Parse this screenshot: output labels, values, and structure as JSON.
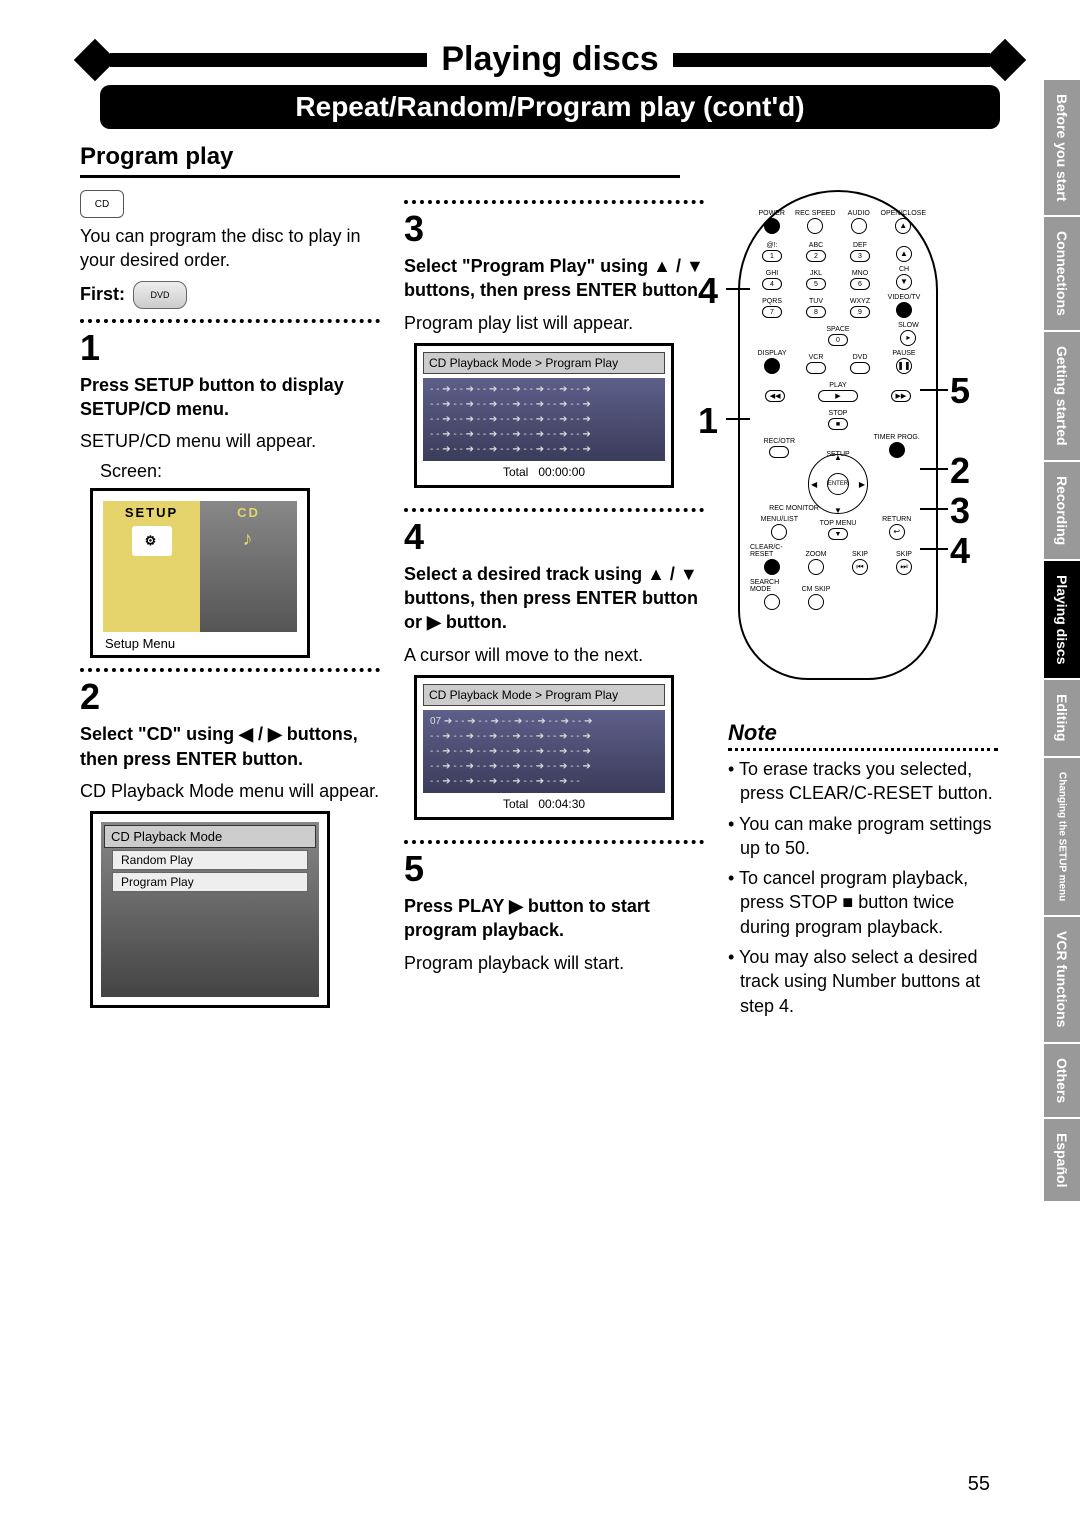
{
  "header": {
    "title": "Playing discs",
    "subtitle": "Repeat/Random/Program play (cont'd)"
  },
  "section_title": "Program play",
  "intro": "You can program the disc to play in your desired order.",
  "first_label": "First:",
  "steps": {
    "s1": {
      "num": "1",
      "head": "Press SETUP button to display SETUP/CD menu.",
      "body": "SETUP/CD menu will appear.",
      "screen_label": "Screen:",
      "setup_tab": "SETUP",
      "cd_tab": "CD",
      "caption": "Setup Menu"
    },
    "s2": {
      "num": "2",
      "head": "Select \"CD\" using ◀ / ▶ buttons, then press ENTER button.",
      "body": "CD Playback Mode menu will appear.",
      "list_hdr": "CD Playback Mode",
      "opt1": "Random Play",
      "opt2": "Program Play"
    },
    "s3": {
      "num": "3",
      "head": "Select \"Program Play\" using ▲ / ▼ buttons, then press ENTER button.",
      "body": "Program play list will appear.",
      "breadcrumb": "CD Playback Mode > Program Play",
      "row": "- - ➔ - - ➔ - - ➔ - - ➔ - - ➔ - - ➔ - - ➔",
      "total_label": "Total",
      "total_time": "00:00:00"
    },
    "s4": {
      "num": "4",
      "head": "Select a desired track using ▲ / ▼ buttons, then press ENTER button or ▶ button.",
      "body": "A cursor will move to the next.",
      "breadcrumb": "CD Playback Mode > Program Play",
      "row1": "07 ➔ - - ➔ - - ➔ - - ➔ - - ➔ - - ➔ - - ➔",
      "row": "- - ➔ - - ➔ - - ➔ - - ➔ - - ➔ - - ➔ - - ➔",
      "rowlast": "- - ➔ - - ➔ - - ➔ - - ➔ - - ➔ - - ➔ - -",
      "total_label": "Total",
      "total_time": "00:04:30"
    },
    "s5": {
      "num": "5",
      "head": "Press PLAY ▶ button to start program playback.",
      "body": "Program playback will start."
    }
  },
  "note": {
    "title": "Note",
    "items": [
      "To erase tracks you selected, press CLEAR/C-RESET button.",
      "You can make program settings up to 50.",
      "To cancel program playback, press STOP ■ button twice during program playback.",
      "You may also select a desired track using Number buttons at step 4."
    ]
  },
  "remote": {
    "labels": {
      "power": "POWER",
      "recspeed": "REC SPEED",
      "audio": "AUDIO",
      "openclose": "OPEN/CLOSE",
      "abc": "ABC",
      "def": "DEF",
      "ghi": "GHI",
      "jkl": "JKL",
      "mno": "MNO",
      "ch": "CH",
      "pqrs": "PQRS",
      "tuv": "TUV",
      "wxyz": "WXYZ",
      "videotv": "VIDEO/TV",
      "space": "SPACE",
      "slow": "SLOW",
      "display": "DISPLAY",
      "vcr": "VCR",
      "dvd": "DVD",
      "pause": "PAUSE",
      "play": "PLAY",
      "stop": "STOP",
      "recotr": "REC/OTR",
      "setup": "SETUP",
      "timerprog": "TIMER PROG.",
      "enter": "ENTER",
      "recmonitor": "REC MONITOR",
      "menulist": "MENU/LIST",
      "topmenu": "TOP MENU",
      "return": "RETURN",
      "clear": "CLEAR/C-RESET",
      "zoom": "ZOOM",
      "skip": "SKIP",
      "search": "SEARCH MODE",
      "cmskip": "CM SKIP"
    }
  },
  "callouts": {
    "c1": "1",
    "c2": "2",
    "c3": "3",
    "c4": "4",
    "c5": "5"
  },
  "tabs": [
    {
      "label": "Before you start",
      "active": false
    },
    {
      "label": "Connections",
      "active": false
    },
    {
      "label": "Getting started",
      "active": false
    },
    {
      "label": "Recording",
      "active": false
    },
    {
      "label": "Playing discs",
      "active": true
    },
    {
      "label": "Editing",
      "active": false
    },
    {
      "label": "Changing the SETUP menu",
      "active": false,
      "small": true
    },
    {
      "label": "VCR functions",
      "active": false
    },
    {
      "label": "Others",
      "active": false
    },
    {
      "label": "Español",
      "active": false
    }
  ],
  "page_number": "55"
}
